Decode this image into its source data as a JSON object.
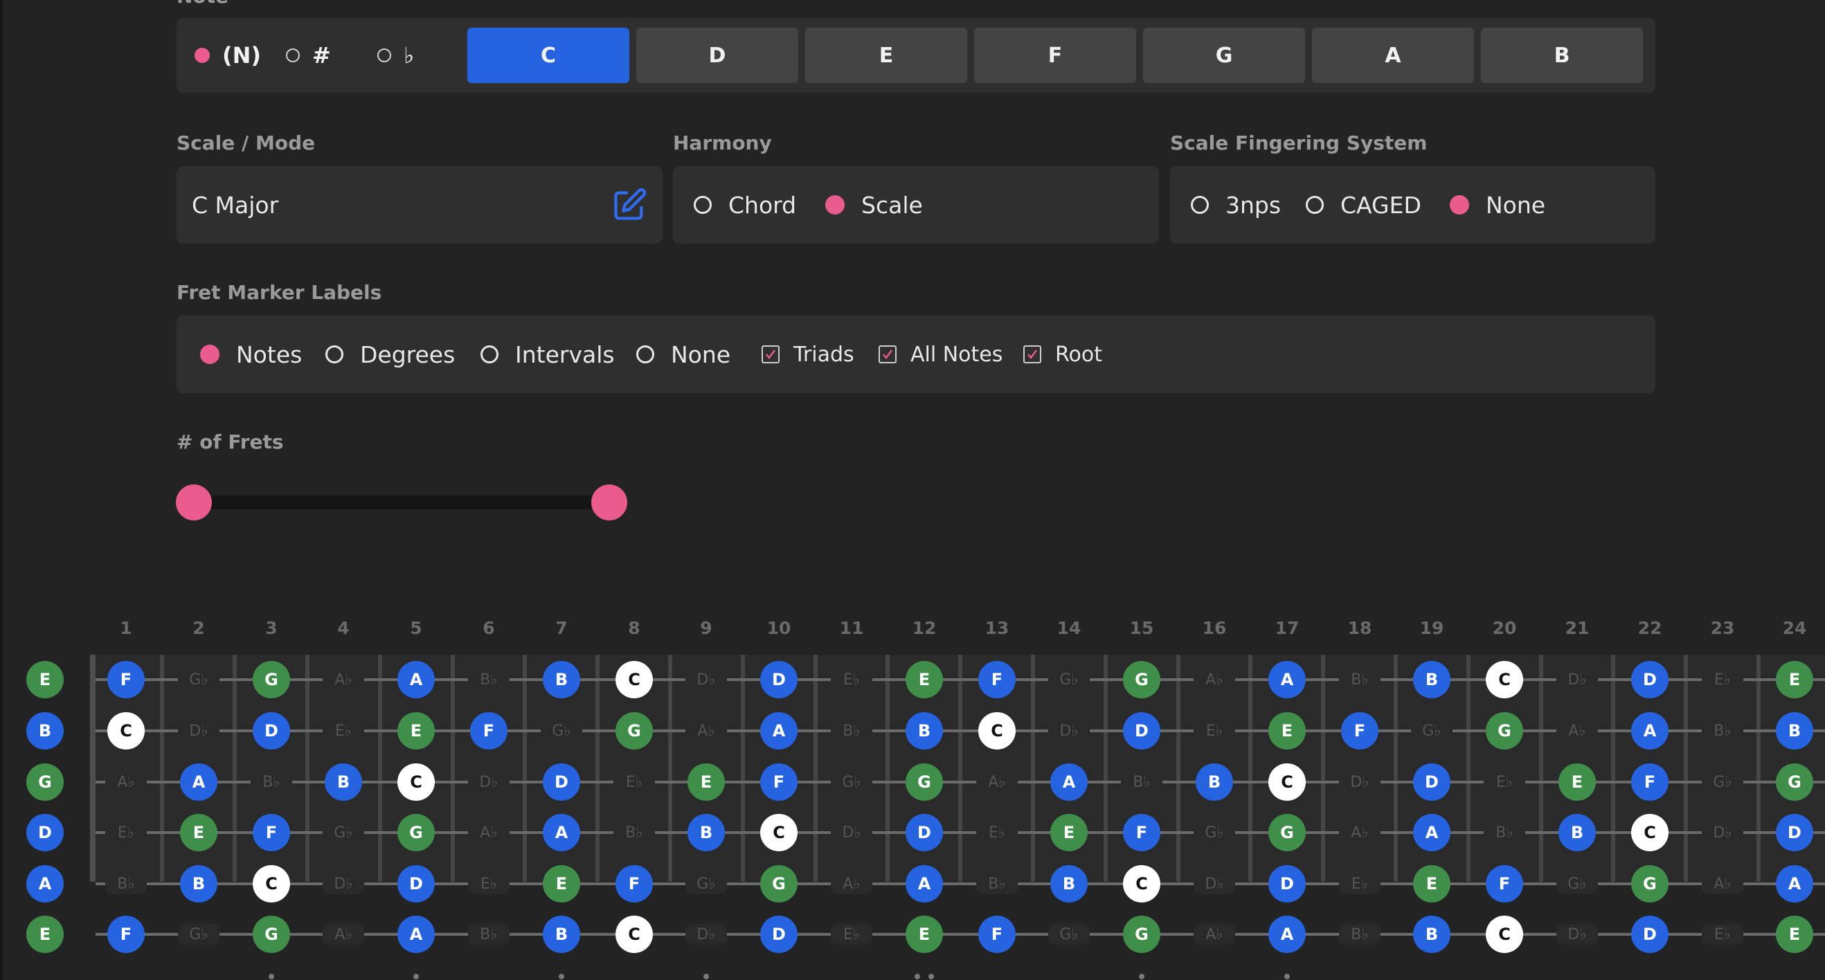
{
  "key_selector": {
    "label": "Note",
    "accidentals": [
      {
        "label": "(N)",
        "selected": true
      },
      {
        "label": "#",
        "selected": false
      },
      {
        "label": "♭",
        "selected": false
      }
    ],
    "keys": [
      "C",
      "D",
      "E",
      "F",
      "G",
      "A",
      "B"
    ],
    "active_key": "C"
  },
  "scale": {
    "label": "Scale / Mode",
    "value": "C Major"
  },
  "harmony": {
    "label": "Harmony",
    "options": [
      {
        "label": "Chord",
        "selected": false
      },
      {
        "label": "Scale",
        "selected": true
      }
    ]
  },
  "fingering": {
    "label": "Scale Fingering System",
    "options": [
      {
        "label": "3nps",
        "selected": false
      },
      {
        "label": "CAGED",
        "selected": false
      },
      {
        "label": "None",
        "selected": true
      }
    ]
  },
  "fret_labels": {
    "label": "Fret Marker Labels",
    "options": [
      {
        "label": "Notes",
        "selected": true
      },
      {
        "label": "Degrees",
        "selected": false
      },
      {
        "label": "Intervals",
        "selected": false
      },
      {
        "label": "None",
        "selected": false
      }
    ],
    "checks": [
      {
        "label": "Triads",
        "checked": true
      },
      {
        "label": "All Notes",
        "checked": true
      },
      {
        "label": "Root",
        "checked": true
      }
    ]
  },
  "frets": {
    "label": "# of Frets"
  },
  "colors": {
    "accent": "#ea5b8e",
    "note_blue": "#2563e0",
    "note_green": "#3f8f4a",
    "root": "#ffffff"
  },
  "fretboard": {
    "fret_numbers": [
      "1",
      "2",
      "3",
      "4",
      "5",
      "6",
      "7",
      "8",
      "9",
      "10",
      "11",
      "12",
      "13",
      "14",
      "15",
      "16",
      "17",
      "18",
      "19",
      "20",
      "21",
      "22",
      "23",
      "24"
    ],
    "strings": [
      {
        "open": "E",
        "open_color": "green",
        "frets": [
          [
            "F",
            "blue"
          ],
          [
            "G♭",
            "dim"
          ],
          [
            "G",
            "green"
          ],
          [
            "A♭",
            "dim"
          ],
          [
            "A",
            "blue"
          ],
          [
            "B♭",
            "dim"
          ],
          [
            "B",
            "blue"
          ],
          [
            "C",
            "white"
          ],
          [
            "D♭",
            "dim"
          ],
          [
            "D",
            "blue"
          ],
          [
            "E♭",
            "dim"
          ],
          [
            "E",
            "green"
          ],
          [
            "F",
            "blue"
          ],
          [
            "G♭",
            "dim"
          ],
          [
            "G",
            "green"
          ],
          [
            "A♭",
            "dim"
          ],
          [
            "A",
            "blue"
          ],
          [
            "B♭",
            "dim"
          ],
          [
            "B",
            "blue"
          ],
          [
            "C",
            "white"
          ],
          [
            "D♭",
            "dim"
          ],
          [
            "D",
            "blue"
          ],
          [
            "E♭",
            "dim"
          ],
          [
            "E",
            "green"
          ]
        ]
      },
      {
        "open": "B",
        "open_color": "blue",
        "frets": [
          [
            "C",
            "white"
          ],
          [
            "D♭",
            "dim"
          ],
          [
            "D",
            "blue"
          ],
          [
            "E♭",
            "dim"
          ],
          [
            "E",
            "green"
          ],
          [
            "F",
            "blue"
          ],
          [
            "G♭",
            "dim"
          ],
          [
            "G",
            "green"
          ],
          [
            "A♭",
            "dim"
          ],
          [
            "A",
            "blue"
          ],
          [
            "B♭",
            "dim"
          ],
          [
            "B",
            "blue"
          ],
          [
            "C",
            "white"
          ],
          [
            "D♭",
            "dim"
          ],
          [
            "D",
            "blue"
          ],
          [
            "E♭",
            "dim"
          ],
          [
            "E",
            "green"
          ],
          [
            "F",
            "blue"
          ],
          [
            "G♭",
            "dim"
          ],
          [
            "G",
            "green"
          ],
          [
            "A♭",
            "dim"
          ],
          [
            "A",
            "blue"
          ],
          [
            "B♭",
            "dim"
          ],
          [
            "B",
            "blue"
          ]
        ]
      },
      {
        "open": "G",
        "open_color": "green",
        "frets": [
          [
            "A♭",
            "dim"
          ],
          [
            "A",
            "blue"
          ],
          [
            "B♭",
            "dim"
          ],
          [
            "B",
            "blue"
          ],
          [
            "C",
            "white"
          ],
          [
            "D♭",
            "dim"
          ],
          [
            "D",
            "blue"
          ],
          [
            "E♭",
            "dim"
          ],
          [
            "E",
            "green"
          ],
          [
            "F",
            "blue"
          ],
          [
            "G♭",
            "dim"
          ],
          [
            "G",
            "green"
          ],
          [
            "A♭",
            "dim"
          ],
          [
            "A",
            "blue"
          ],
          [
            "B♭",
            "dim"
          ],
          [
            "B",
            "blue"
          ],
          [
            "C",
            "white"
          ],
          [
            "D♭",
            "dim"
          ],
          [
            "D",
            "blue"
          ],
          [
            "E♭",
            "dim"
          ],
          [
            "E",
            "green"
          ],
          [
            "F",
            "blue"
          ],
          [
            "G♭",
            "dim"
          ],
          [
            "G",
            "green"
          ]
        ]
      },
      {
        "open": "D",
        "open_color": "blue",
        "frets": [
          [
            "E♭",
            "dim"
          ],
          [
            "E",
            "green"
          ],
          [
            "F",
            "blue"
          ],
          [
            "G♭",
            "dim"
          ],
          [
            "G",
            "green"
          ],
          [
            "A♭",
            "dim"
          ],
          [
            "A",
            "blue"
          ],
          [
            "B♭",
            "dim"
          ],
          [
            "B",
            "blue"
          ],
          [
            "C",
            "white"
          ],
          [
            "D♭",
            "dim"
          ],
          [
            "D",
            "blue"
          ],
          [
            "E♭",
            "dim"
          ],
          [
            "E",
            "green"
          ],
          [
            "F",
            "blue"
          ],
          [
            "G♭",
            "dim"
          ],
          [
            "G",
            "green"
          ],
          [
            "A♭",
            "dim"
          ],
          [
            "A",
            "blue"
          ],
          [
            "B♭",
            "dim"
          ],
          [
            "B",
            "blue"
          ],
          [
            "C",
            "white"
          ],
          [
            "D♭",
            "dim"
          ],
          [
            "D",
            "blue"
          ]
        ]
      },
      {
        "open": "A",
        "open_color": "blue",
        "frets": [
          [
            "B♭",
            "dim"
          ],
          [
            "B",
            "blue"
          ],
          [
            "C",
            "white"
          ],
          [
            "D♭",
            "dim"
          ],
          [
            "D",
            "blue"
          ],
          [
            "E♭",
            "dim"
          ],
          [
            "E",
            "green"
          ],
          [
            "F",
            "blue"
          ],
          [
            "G♭",
            "dim"
          ],
          [
            "G",
            "green"
          ],
          [
            "A♭",
            "dim"
          ],
          [
            "A",
            "blue"
          ],
          [
            "B♭",
            "dim"
          ],
          [
            "B",
            "blue"
          ],
          [
            "C",
            "white"
          ],
          [
            "D♭",
            "dim"
          ],
          [
            "D",
            "blue"
          ],
          [
            "E♭",
            "dim"
          ],
          [
            "E",
            "green"
          ],
          [
            "F",
            "blue"
          ],
          [
            "G♭",
            "dim"
          ],
          [
            "G",
            "green"
          ],
          [
            "A♭",
            "dim"
          ],
          [
            "A",
            "blue"
          ]
        ]
      },
      {
        "open": "E",
        "open_color": "green",
        "frets": [
          [
            "F",
            "blue"
          ],
          [
            "G♭",
            "dim"
          ],
          [
            "G",
            "green"
          ],
          [
            "A♭",
            "dim"
          ],
          [
            "A",
            "blue"
          ],
          [
            "B♭",
            "dim"
          ],
          [
            "B",
            "blue"
          ],
          [
            "C",
            "white"
          ],
          [
            "D♭",
            "dim"
          ],
          [
            "D",
            "blue"
          ],
          [
            "E♭",
            "dim"
          ],
          [
            "E",
            "green"
          ],
          [
            "F",
            "blue"
          ],
          [
            "G♭",
            "dim"
          ],
          [
            "G",
            "green"
          ],
          [
            "A♭",
            "dim"
          ],
          [
            "A",
            "blue"
          ],
          [
            "B♭",
            "dim"
          ],
          [
            "B",
            "blue"
          ],
          [
            "C",
            "white"
          ],
          [
            "D♭",
            "dim"
          ],
          [
            "D",
            "blue"
          ],
          [
            "E♭",
            "dim"
          ],
          [
            "E",
            "green"
          ]
        ]
      }
    ]
  }
}
